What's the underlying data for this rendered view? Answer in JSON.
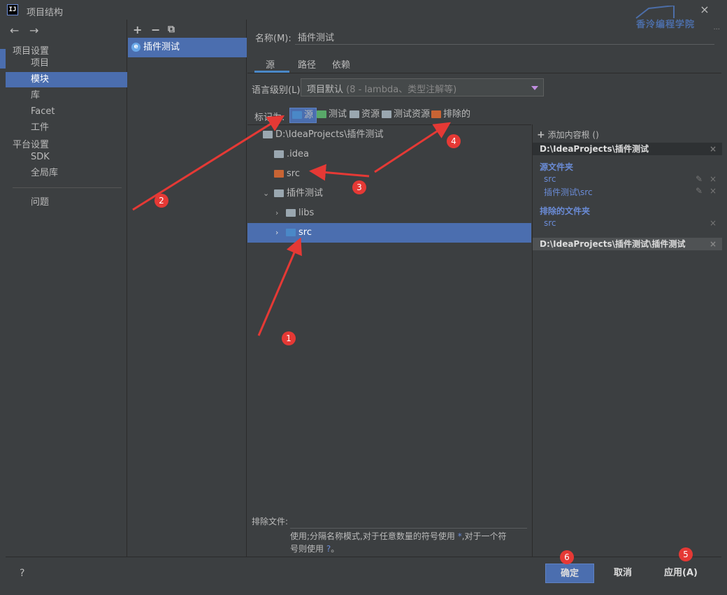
{
  "window": {
    "title": "项目结构",
    "app_icon": "IJ",
    "close": "×"
  },
  "watermark": {
    "text": "香泠编程学院",
    "dots": "..."
  },
  "nav": {
    "back": "←",
    "forward": "→",
    "project_settings": "项目设置",
    "items_project": [
      "项目",
      "模块",
      "库",
      "Facet",
      "工件"
    ],
    "platform_settings": "平台设置",
    "items_platform": [
      "SDK",
      "全局库"
    ],
    "problems": "问题",
    "selected": "模块"
  },
  "modules": {
    "add": "+",
    "remove": "−",
    "copy": "⧉",
    "item": "插件测试",
    "item_icon": "e"
  },
  "form": {
    "name_label": "名称(M):",
    "name_value": "插件测试",
    "tabs": [
      "源",
      "路径",
      "依赖"
    ],
    "lang_label": "语言级别(L):",
    "lang_value": "项目默认",
    "lang_hint": "(8 - lambda、类型注解等)",
    "mark_label": "标记为:",
    "marks": [
      {
        "label": "源",
        "color": "#4a88c7"
      },
      {
        "label": "测试",
        "color": "#59a869"
      },
      {
        "label": "资源",
        "color": "#9aa7b0"
      },
      {
        "label": "测试资源",
        "color": "#9aa7b0"
      },
      {
        "label": "排除的",
        "color": "#c86434"
      }
    ]
  },
  "tree": {
    "rows": [
      {
        "label": "D:\\IdeaProjects\\插件测试",
        "chev": "⌄",
        "color": "#9aa7b0"
      },
      {
        "label": ".idea",
        "chev": "",
        "color": "#9aa7b0"
      },
      {
        "label": "src",
        "chev": "",
        "color": "#c86434"
      },
      {
        "label": "插件测试",
        "chev": "⌄",
        "color": "#9aa7b0"
      },
      {
        "label": "libs",
        "chev": "›",
        "color": "#9aa7b0"
      },
      {
        "label": "src",
        "chev": "›",
        "color": "#4a88c7"
      }
    ]
  },
  "content_roots": {
    "add_label": "添加内容根",
    "add_icon": "+",
    "add_suffix": "()",
    "root1": "D:\\IdeaProjects\\插件测试",
    "source_folders_label": "源文件夹",
    "source_folders": [
      "src",
      "插件测试\\src"
    ],
    "excluded_label": "排除的文件夹",
    "excluded": [
      "src"
    ],
    "root2": "D:\\IdeaProjects\\插件测试\\插件测试"
  },
  "exclude": {
    "label": "排除文件:",
    "help_line1_a": "使用;分隔名称模式,对于任意数量的符号使用 ",
    "help_star": "*",
    "help_line1_b": ",对于一个符",
    "help_line2_a": "号则使用 ",
    "help_q": "?",
    "help_line2_b": "。"
  },
  "buttons": {
    "help": "?",
    "ok": "确定",
    "cancel": "取消",
    "apply": "应用(A)"
  },
  "badges": [
    "1",
    "2",
    "3",
    "4",
    "5",
    "6"
  ],
  "colors": {
    "accent": "#4b6eaf",
    "annotation": "#e53935"
  }
}
